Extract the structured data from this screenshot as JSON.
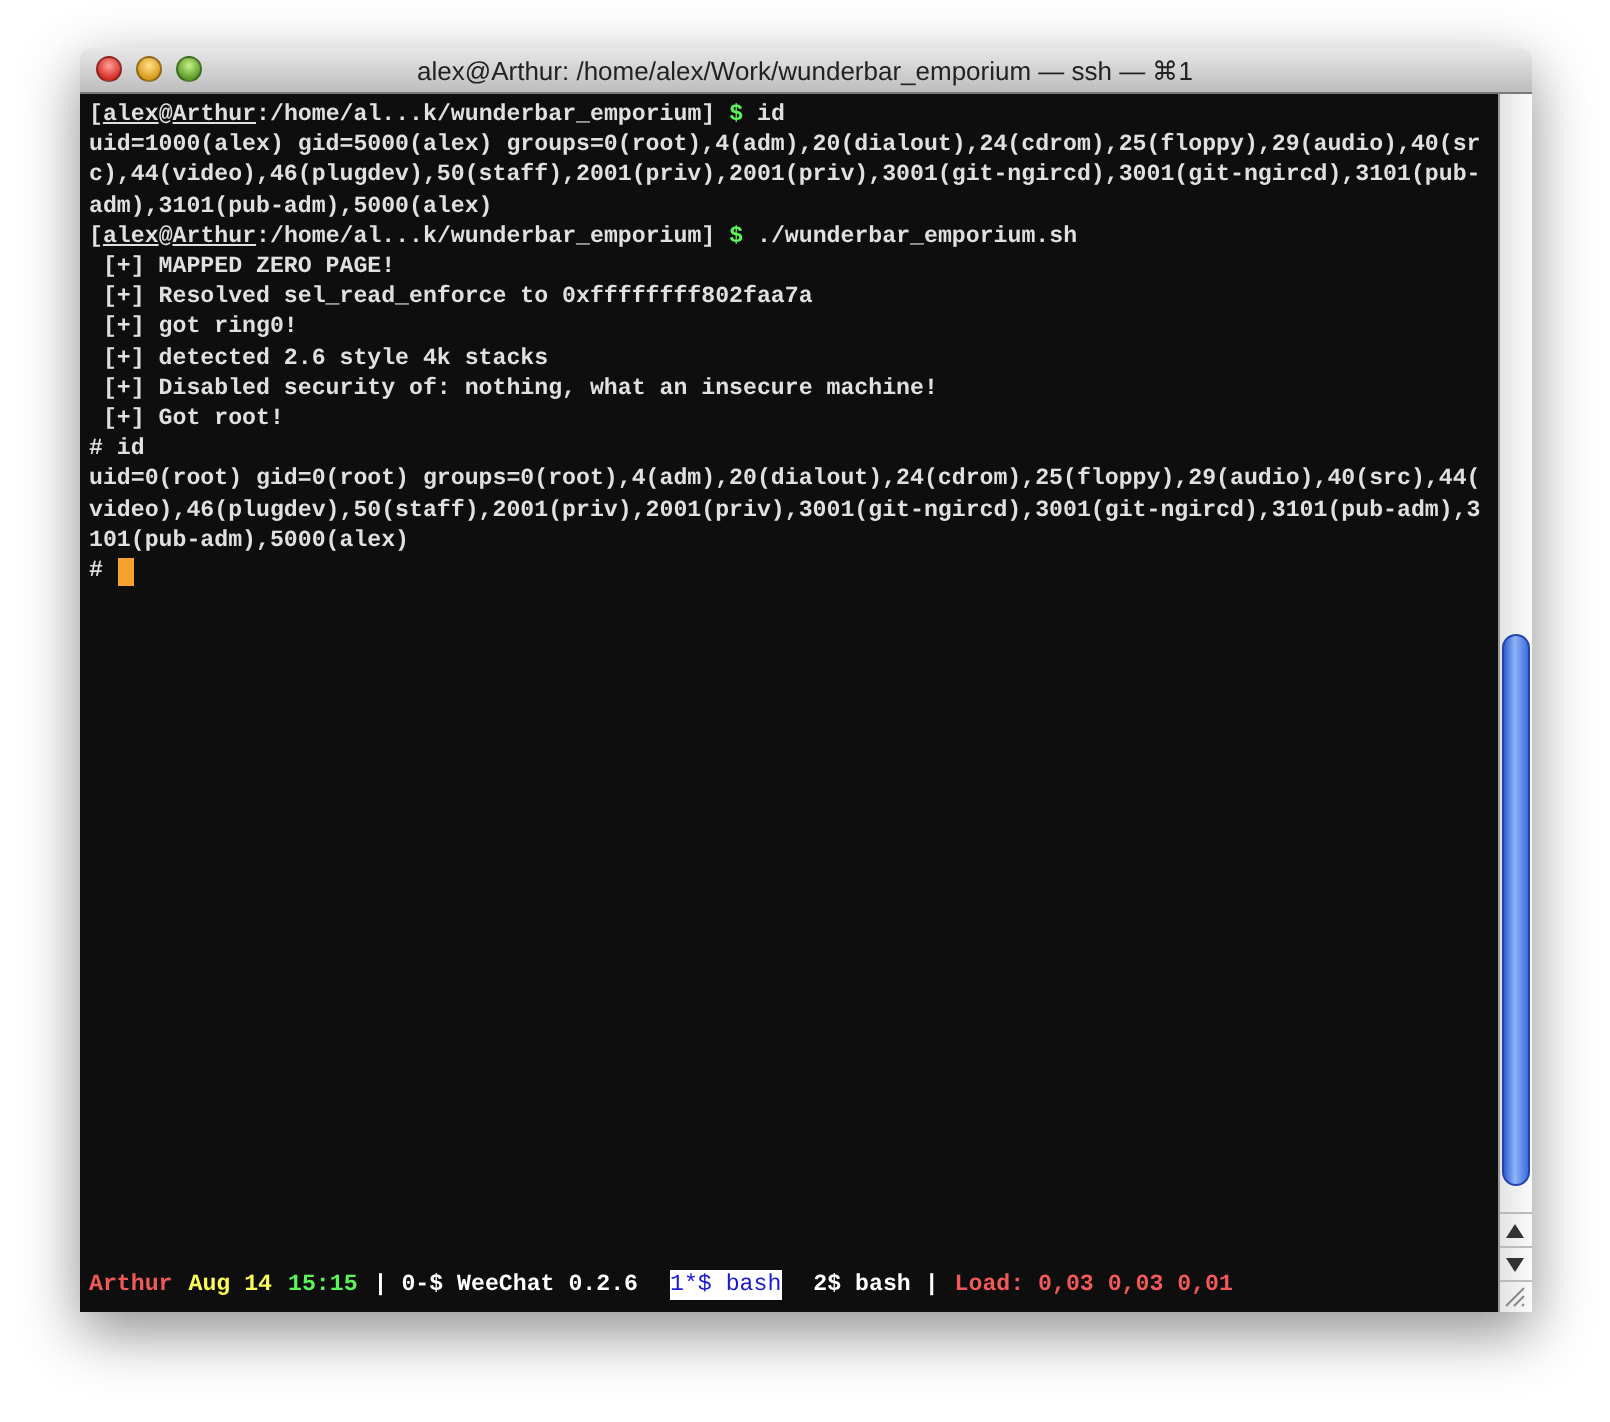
{
  "window": {
    "title": "alex@Arthur: /home/alex/Work/wunderbar_emporium — ssh — ⌘1"
  },
  "terminal": {
    "lines": [
      {
        "kind": "prompt",
        "parts": [
          {
            "text": "[",
            "kind": "plain"
          },
          {
            "text": "alex",
            "kind": "user"
          },
          {
            "text": "@",
            "kind": "plain"
          },
          {
            "text": "Arthur",
            "kind": "host"
          },
          {
            "text": ":/home/al...k/wunderbar_emporium]",
            "kind": "path"
          },
          {
            "text": " $",
            "kind": "symbol"
          },
          {
            "text": " id",
            "kind": "command"
          }
        ]
      },
      {
        "kind": "output",
        "text": "uid=1000(alex) gid=5000(alex) groups=0(root),4(adm),20(dialout),24(cdrom),25(floppy),29(audio),40(sr"
      },
      {
        "kind": "output",
        "text": "c),44(video),46(plugdev),50(staff),2001(priv),2001(priv),3001(git-ngircd),3001(git-ngircd),3101(pub-"
      },
      {
        "kind": "output",
        "text": "adm),3101(pub-adm),5000(alex)"
      },
      {
        "kind": "prompt",
        "parts": [
          {
            "text": "[",
            "kind": "plain"
          },
          {
            "text": "alex",
            "kind": "user"
          },
          {
            "text": "@",
            "kind": "plain"
          },
          {
            "text": "Arthur",
            "kind": "host"
          },
          {
            "text": ":/home/al...k/wunderbar_emporium]",
            "kind": "path"
          },
          {
            "text": " $",
            "kind": "symbol"
          },
          {
            "text": " ./wunderbar_emporium.sh",
            "kind": "command"
          }
        ]
      },
      {
        "kind": "output",
        "text": " [+] MAPPED ZERO PAGE!"
      },
      {
        "kind": "output",
        "text": " [+] Resolved sel_read_enforce to 0xffffffff802faa7a"
      },
      {
        "kind": "output",
        "text": " [+] got ring0!"
      },
      {
        "kind": "output",
        "text": " [+] detected 2.6 style 4k stacks"
      },
      {
        "kind": "output",
        "text": " [+] Disabled security of: nothing, what an insecure machine!"
      },
      {
        "kind": "output",
        "text": " [+] Got root!"
      },
      {
        "kind": "output",
        "text": "# id"
      },
      {
        "kind": "output",
        "text": "uid=0(root) gid=0(root) groups=0(root),4(adm),20(dialout),24(cdrom),25(floppy),29(audio),40(src),44("
      },
      {
        "kind": "output",
        "text": "video),46(plugdev),50(staff),2001(priv),2001(priv),3001(git-ngircd),3001(git-ngircd),3101(pub-adm),3"
      },
      {
        "kind": "output",
        "text": "101(pub-adm),5000(alex)"
      },
      {
        "kind": "cursor",
        "text": "#"
      }
    ]
  },
  "status_bar": [
    {
      "text": "Arthur",
      "color": "#f25a5a",
      "selected": false
    },
    {
      "text": "Aug 14",
      "color": "#fbfb5a",
      "selected": false
    },
    {
      "text": "15:15",
      "color": "#5cf55c",
      "selected": false
    },
    {
      "text": "| 0-$ WeeChat 0.2.6",
      "color": "#ffffff",
      "selected": false
    },
    {
      "text": "1*$ bash",
      "color": "#1a1ad0",
      "selected": true
    },
    {
      "text": "2$ bash |",
      "color": "#ffffff",
      "selected": false
    },
    {
      "text": "Load: 0,03 0,03 0,01",
      "color": "#f25a5a",
      "selected": false
    }
  ]
}
